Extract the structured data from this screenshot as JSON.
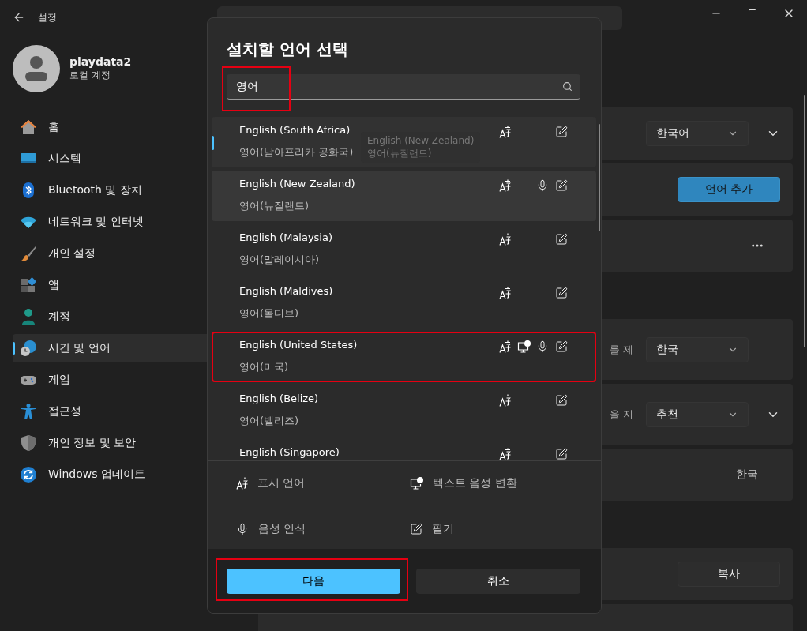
{
  "window": {
    "title": "설정"
  },
  "user": {
    "name": "playdata2",
    "account": "로컬 계정"
  },
  "nav": [
    {
      "label": "홈",
      "selected": false
    },
    {
      "label": "시스템",
      "selected": false
    },
    {
      "label": "Bluetooth 및 장치",
      "selected": false
    },
    {
      "label": "네트워크 및 인터넷",
      "selected": false
    },
    {
      "label": "개인 설정",
      "selected": false
    },
    {
      "label": "앱",
      "selected": false
    },
    {
      "label": "계정",
      "selected": false
    },
    {
      "label": "시간 및 언어",
      "selected": true
    },
    {
      "label": "게임",
      "selected": false
    },
    {
      "label": "접근성",
      "selected": false
    },
    {
      "label": "개인 정보 및 보안",
      "selected": false
    },
    {
      "label": "Windows 업데이트",
      "selected": false
    }
  ],
  "settings_groups": [
    [
      {
        "kind": "dropdown",
        "value": "한국어",
        "expandable": true
      },
      {
        "kind": "button",
        "label": "언어 추가",
        "primary": true
      },
      {
        "kind": "more"
      }
    ],
    [
      {
        "kind": "dropdown",
        "description": "를 제",
        "value": "한국",
        "expandable": false
      },
      {
        "kind": "dropdown",
        "description": "을 지",
        "value": "추천",
        "expandable": true
      },
      {
        "kind": "text",
        "value": "한국"
      }
    ],
    [
      {
        "kind": "button",
        "label": "복사",
        "primary": false
      },
      {
        "kind": "empty"
      }
    ]
  ],
  "dialog": {
    "title": "설치할 언어 선택",
    "search": {
      "value": "영어",
      "highlighted": true
    },
    "languages": [
      {
        "name": "English (South Africa)",
        "native": "영어(남아프리카 공화국)",
        "display": true,
        "tts": false,
        "speech": false,
        "handwriting": true,
        "selected": true,
        "hovered": false,
        "highlighted": false
      },
      {
        "name": "English (New Zealand)",
        "native": "영어(뉴질랜드)",
        "display": true,
        "tts": false,
        "speech": true,
        "handwriting": true,
        "selected": false,
        "hovered": true,
        "highlighted": false
      },
      {
        "name": "English (Malaysia)",
        "native": "영어(말레이시아)",
        "display": true,
        "tts": false,
        "speech": false,
        "handwriting": true,
        "selected": false,
        "hovered": false,
        "highlighted": false
      },
      {
        "name": "English (Maldives)",
        "native": "영어(몰디브)",
        "display": true,
        "tts": false,
        "speech": false,
        "handwriting": true,
        "selected": false,
        "hovered": false,
        "highlighted": false
      },
      {
        "name": "English (United States)",
        "native": "영어(미국)",
        "display": true,
        "tts": true,
        "speech": true,
        "handwriting": true,
        "selected": false,
        "hovered": false,
        "highlighted": true
      },
      {
        "name": "English (Belize)",
        "native": "영어(벨리즈)",
        "display": true,
        "tts": false,
        "speech": false,
        "handwriting": true,
        "selected": false,
        "hovered": false,
        "highlighted": false
      },
      {
        "name": "English (Singapore)",
        "display": true,
        "tts": false,
        "speech": false,
        "handwriting": true,
        "selected": false,
        "hovered": false,
        "highlighted": false
      }
    ],
    "tooltip": {
      "name": "English (New Zealand)",
      "native": "영어(뉴질랜드)"
    },
    "legend": [
      {
        "kind": "display",
        "label": "표시 언어"
      },
      {
        "kind": "tts",
        "label": "텍스트 음성 변환"
      },
      {
        "kind": "speech",
        "label": "음성 인식"
      },
      {
        "kind": "handwriting",
        "label": "필기"
      }
    ],
    "buttons": [
      {
        "label": "다음",
        "primary": true,
        "highlighted": true
      },
      {
        "label": "취소",
        "primary": false,
        "highlighted": false
      }
    ]
  }
}
